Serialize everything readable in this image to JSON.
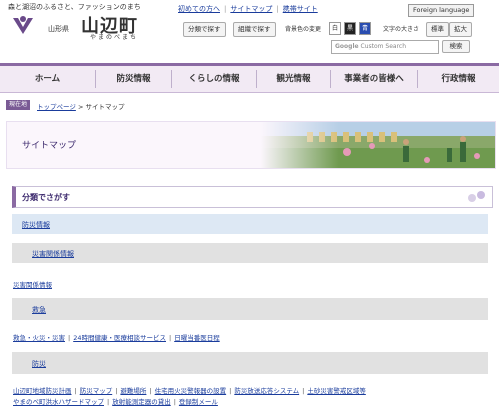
{
  "header": {
    "tagline": "森と湖沼のふるさと、ファッションのまち",
    "prefecture": "山形県",
    "town": "山辺町",
    "town_reading": "やまのべまち",
    "top_links": [
      "初めての方へ",
      "サイトマップ",
      "携帯サイト"
    ],
    "search_category_button": "分類で探す",
    "search_org_button": "組織で探す",
    "bg_color_label": "背景色の変更",
    "bg_options": [
      "白",
      "黒",
      "青"
    ],
    "text_size_label": "文字の大きさ",
    "text_size_options": [
      "標準",
      "拡大"
    ],
    "foreign_language": "Foreign language",
    "search_placeholder_brand": "Google",
    "search_placeholder": "Custom Search",
    "search_button": "検索"
  },
  "nav": {
    "items": [
      "ホーム",
      "防災情報",
      "くらしの情報",
      "観光情報",
      "事業者の皆様へ",
      "行政情報"
    ]
  },
  "breadcrumb": {
    "badge": "現在地",
    "home": "トップページ",
    "separator": ">",
    "current": "サイトマップ"
  },
  "banner": {
    "title": "サイトマップ"
  },
  "section": {
    "title": "分類でさがす"
  },
  "sitemap": {
    "cat1": "防災情報",
    "cat2": "災害関係情報",
    "cat2_link": "災害関係情報",
    "cat3": "救急",
    "cat3_links": [
      "救急・火災・災害",
      "24時間健康・医療相談サービス",
      "日曜当番医日程"
    ],
    "cat4": "防災",
    "cat4_links_row1": [
      "山辺町地域防災計画",
      "防災マップ",
      "避難場所",
      "住宅用火災警報器の設置",
      "防災放送応答システム",
      "土砂災害警戒区域等"
    ],
    "cat4_links_row2": [
      "やまのべ町洪水ハザードマップ",
      "放射能測定器の貸出",
      "登録制メール"
    ]
  },
  "colors": {
    "accent": "#8b6aa3",
    "nav_bg": "#f2eaf4",
    "link": "#1a3c9c"
  }
}
